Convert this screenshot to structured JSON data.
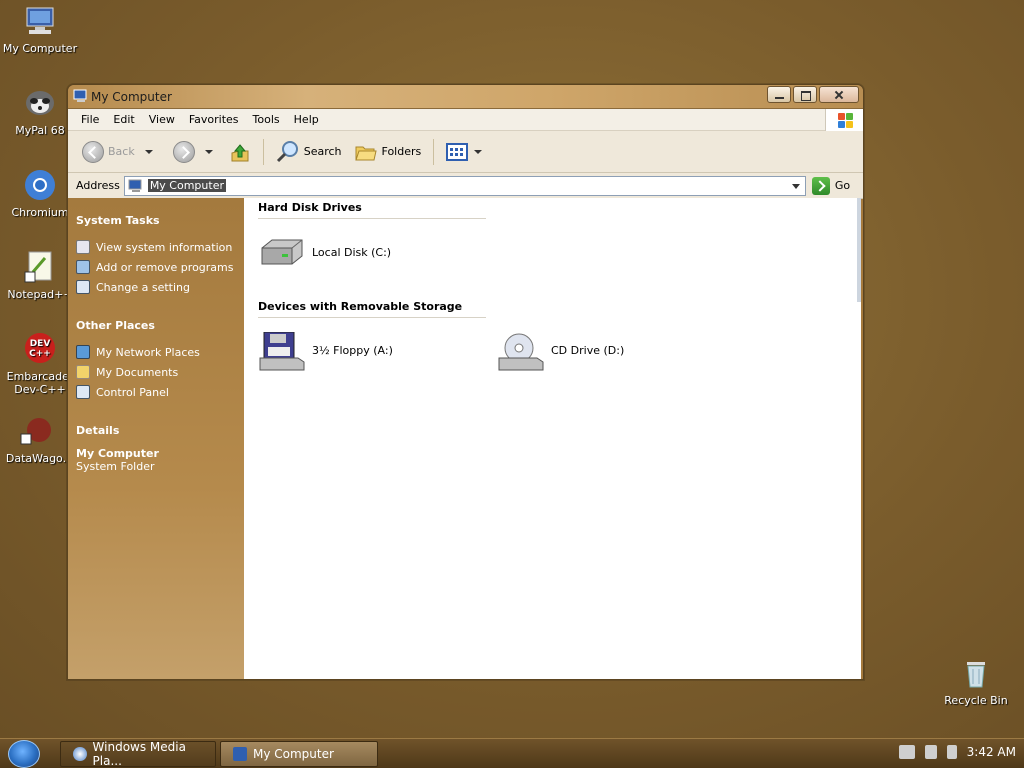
{
  "desktop": {
    "icons": [
      {
        "label": "My Computer"
      },
      {
        "label": "MyPal 68"
      },
      {
        "label": "Chromium"
      },
      {
        "label": "Notepad++"
      },
      {
        "label": "Embarcader Dev-C++"
      },
      {
        "label": "DataWago."
      },
      {
        "label": "Recycle Bin"
      }
    ]
  },
  "window": {
    "title": "My Computer",
    "menu": [
      "File",
      "Edit",
      "View",
      "Favorites",
      "Tools",
      "Help"
    ],
    "toolbar": {
      "back_label": "Back",
      "search_label": "Search",
      "folders_label": "Folders"
    },
    "address": {
      "label": "Address",
      "value": "My Computer",
      "go_label": "Go"
    },
    "taskpane": {
      "system_tasks": {
        "title": "System Tasks",
        "items": [
          "View system information",
          "Add or remove programs",
          "Change a setting"
        ]
      },
      "other_places": {
        "title": "Other Places",
        "items": [
          "My Network Places",
          "My Documents",
          "Control Panel"
        ]
      },
      "details": {
        "title": "Details",
        "name": "My Computer",
        "type": "System Folder"
      }
    },
    "groups": {
      "hard_disk": {
        "title": "Hard Disk Drives",
        "items": [
          "Local Disk (C:)"
        ]
      },
      "removable": {
        "title": "Devices with Removable Storage",
        "items": [
          "3½ Floppy (A:)",
          "CD Drive (D:)"
        ]
      }
    }
  },
  "taskbar": {
    "buttons": [
      "Windows Media Pla...",
      "My Computer"
    ],
    "clock": "3:42 AM"
  },
  "colors": {
    "desktop": "#7b5e2f",
    "taskpane": "#a47a3e",
    "selection": "#4b4b4b"
  }
}
